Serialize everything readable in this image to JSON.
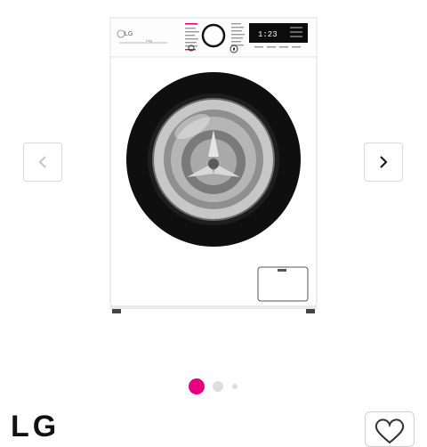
{
  "product": {
    "brand_name": "LG",
    "image_icon": "washing-machine-product-image",
    "appliance_logo": "LG",
    "capacity_label": "9 kg",
    "display_readout": "1:23",
    "colors": {
      "body": "#ffffff",
      "door_rim": "#111111",
      "accent": "#e6007e"
    }
  },
  "gallery": {
    "prev_icon": "chevron-left-icon",
    "next_icon": "chevron-right-icon",
    "dot_count": 3,
    "active_dot": 1,
    "active_color": "#e6007e",
    "inactive_color": "#dedede"
  },
  "actions": {
    "wishlist_icon": "heart-outline-icon"
  }
}
